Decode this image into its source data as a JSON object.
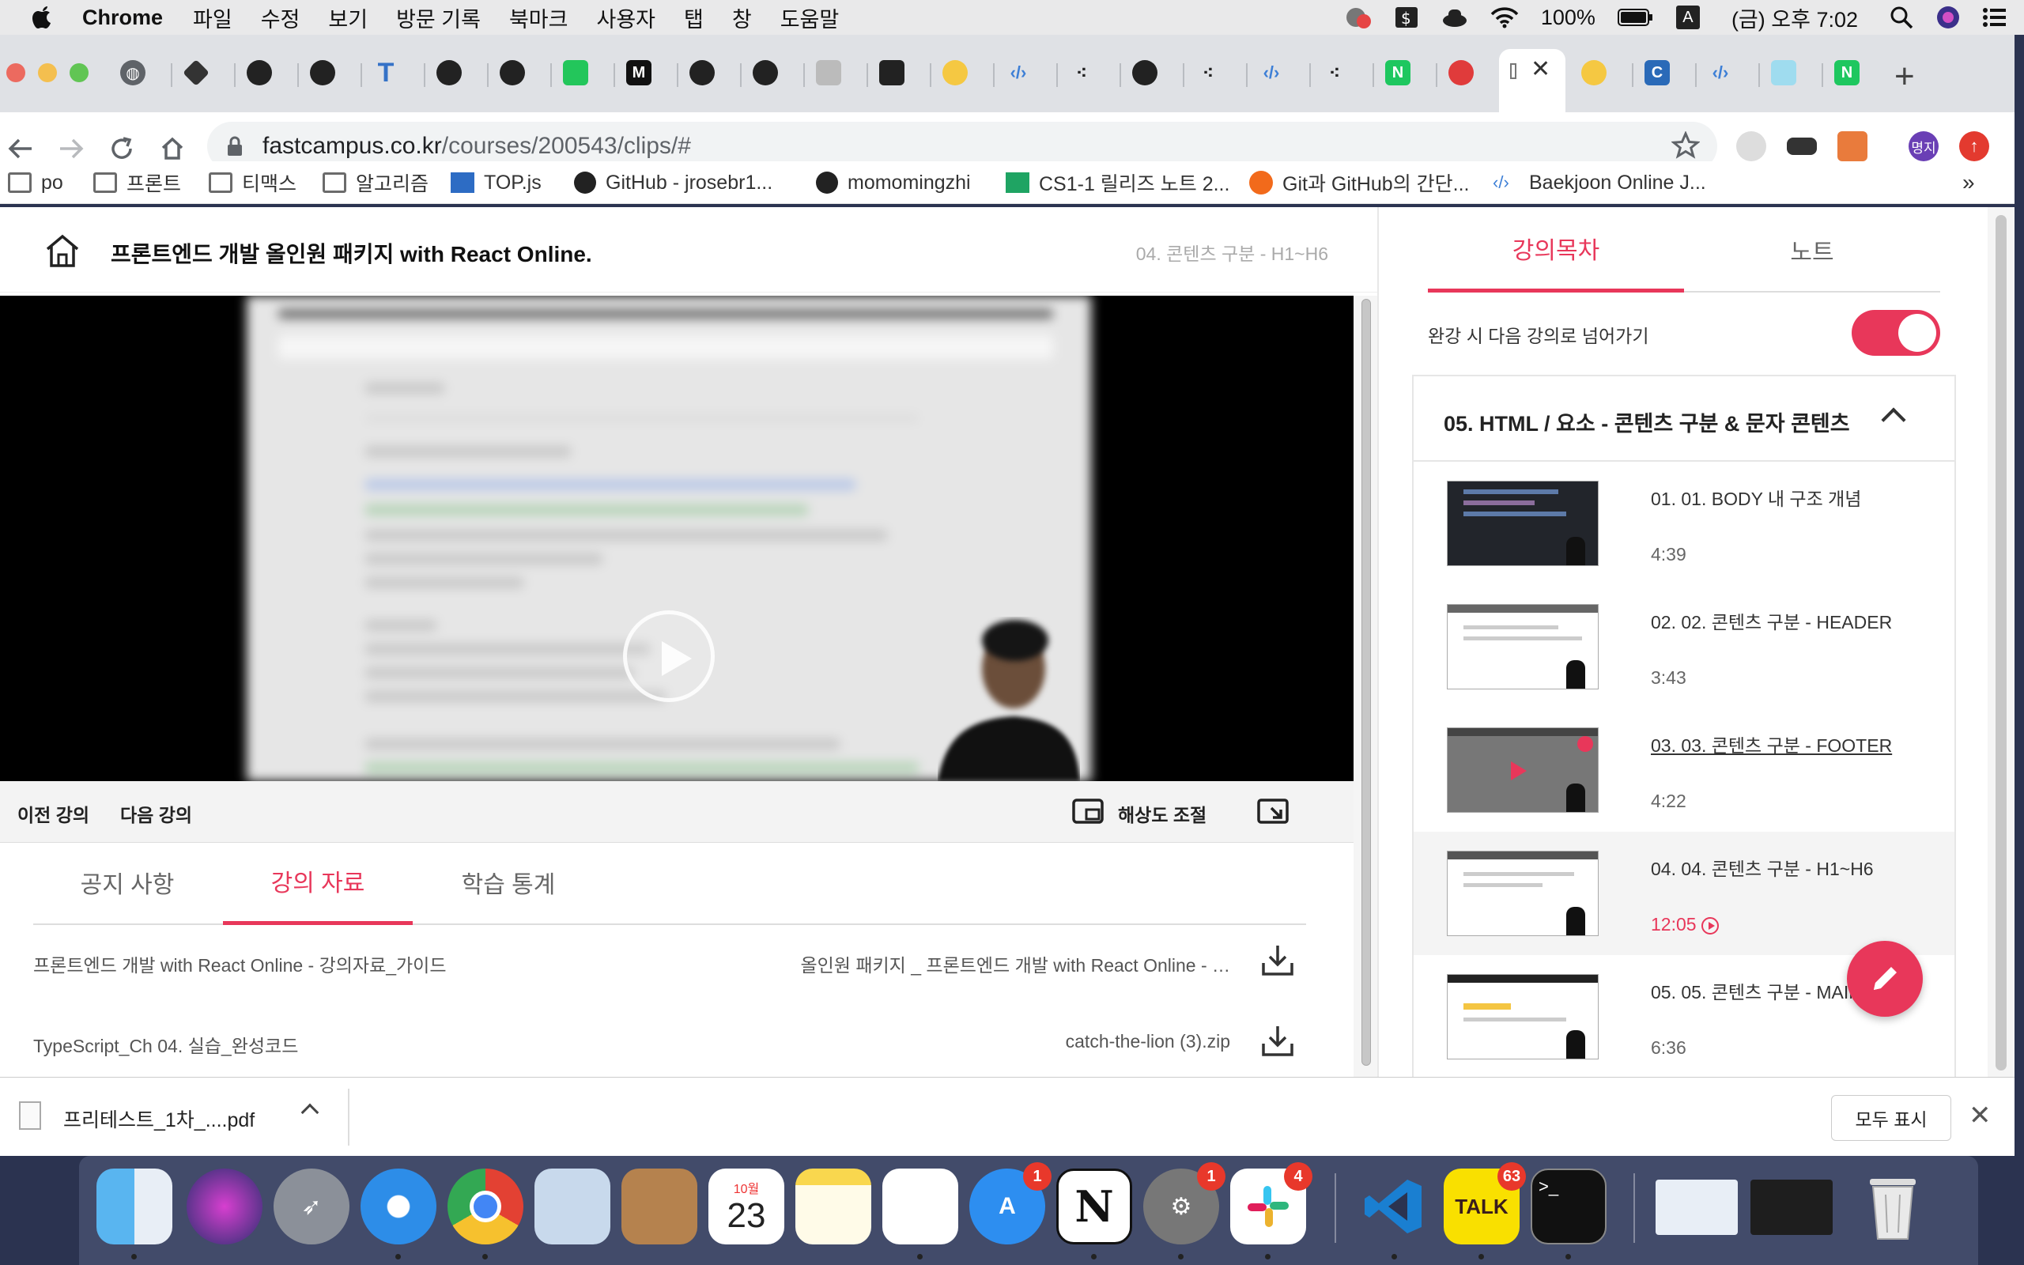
{
  "menubar": {
    "app_name": "Chrome",
    "menus": [
      "파일",
      "수정",
      "보기",
      "방문 기록",
      "북마크",
      "사용자",
      "탭",
      "창",
      "도움말"
    ],
    "battery": "100%",
    "input_source": "A",
    "clock": "(금) 오후 7:02"
  },
  "browser": {
    "url_host": "fastcampus.co.kr",
    "url_path": "/courses/200543/clips/#",
    "profile_label": "명지",
    "bookmarks": [
      "po",
      "프론트",
      "티맥스",
      "알고리즘",
      "TOP.js",
      "GitHub - jrosebr1...",
      "momomingzhi",
      "CS1-1 릴리즈 노트 2...",
      "Git과 GitHub의 간단...",
      "Baekjoon Online J..."
    ],
    "overflow": "»"
  },
  "header": {
    "course_title": "프론트엔드 개발 올인원 패키지 with React Online.",
    "lecture_crumb": "04. 콘텐츠 구분 - H1~H6"
  },
  "controls": {
    "prev": "이전 강의",
    "next": "다음 강의",
    "resolution": "해상도 조절"
  },
  "main_tabs": [
    "공지 사항",
    "강의 자료",
    "학습 통계"
  ],
  "resources": [
    {
      "name": "프론트엔드 개발 with React Online - 강의자료_가이드",
      "file": "올인원 패키지 _ 프론트엔드 개발 with React Online - …"
    },
    {
      "name": "TypeScript_Ch 04. 실습_완성코드",
      "file": "catch-the-lion (3).zip"
    }
  ],
  "panel": {
    "tabs": [
      "강의목차",
      "노트"
    ],
    "autonext_label": "완강 시 다음 강의로 넘어가기",
    "section_title": "05. HTML / 요소 - 콘텐츠 구분 & 문자 콘텐츠",
    "lessons": [
      {
        "title": "01. 01. BODY 내 구조 개념",
        "duration": "4:39"
      },
      {
        "title": "02. 02. 콘텐츠 구분 - HEADER",
        "duration": "3:43"
      },
      {
        "title": "03. 03. 콘텐츠 구분 - FOOTER",
        "duration": "4:22"
      },
      {
        "title": "04. 04. 콘텐츠 구분 - H1~H6",
        "duration": "12:05"
      },
      {
        "title": "05. 05. 콘텐츠 구분 - MAIN",
        "duration": "6:36"
      }
    ]
  },
  "download_shelf": {
    "file": "프리테스트_1차_....pdf",
    "show_all": "모두 표시"
  },
  "dock": {
    "badges": {
      "app_store": "1",
      "system_prefs": "1",
      "slack": "4",
      "kakaotalk": "63"
    },
    "calendar_month": "10월",
    "calendar_day": "23",
    "kakao_label": "TALK"
  },
  "colors": {
    "accent": "#e8375a",
    "dock": "#46506e"
  }
}
